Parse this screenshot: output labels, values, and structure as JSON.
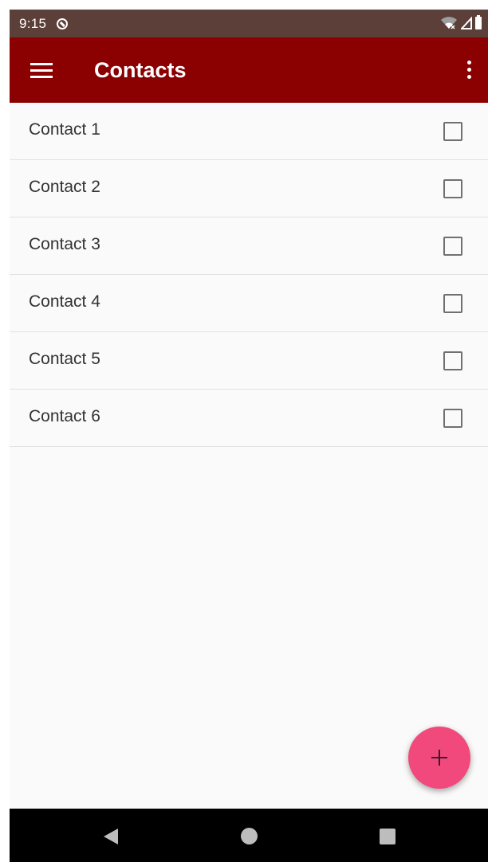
{
  "status_bar": {
    "time": "9:15",
    "icons": [
      "app-notification-icon",
      "wifi-icon",
      "signal-icon",
      "battery-icon"
    ]
  },
  "app_bar": {
    "title": "Contacts",
    "background_color": "#8b0000",
    "icons": [
      "menu-icon",
      "overflow-menu-icon"
    ]
  },
  "contacts": [
    {
      "name": "Contact 1",
      "checked": false
    },
    {
      "name": "Contact 2",
      "checked": false
    },
    {
      "name": "Contact 3",
      "checked": false
    },
    {
      "name": "Contact 4",
      "checked": false
    },
    {
      "name": "Contact 5",
      "checked": false
    },
    {
      "name": "Contact 6",
      "checked": false
    }
  ],
  "fab": {
    "icon": "plus-icon",
    "color": "#f2497d"
  },
  "nav_bar": {
    "icons": [
      "back-icon",
      "home-icon",
      "recents-icon"
    ]
  }
}
